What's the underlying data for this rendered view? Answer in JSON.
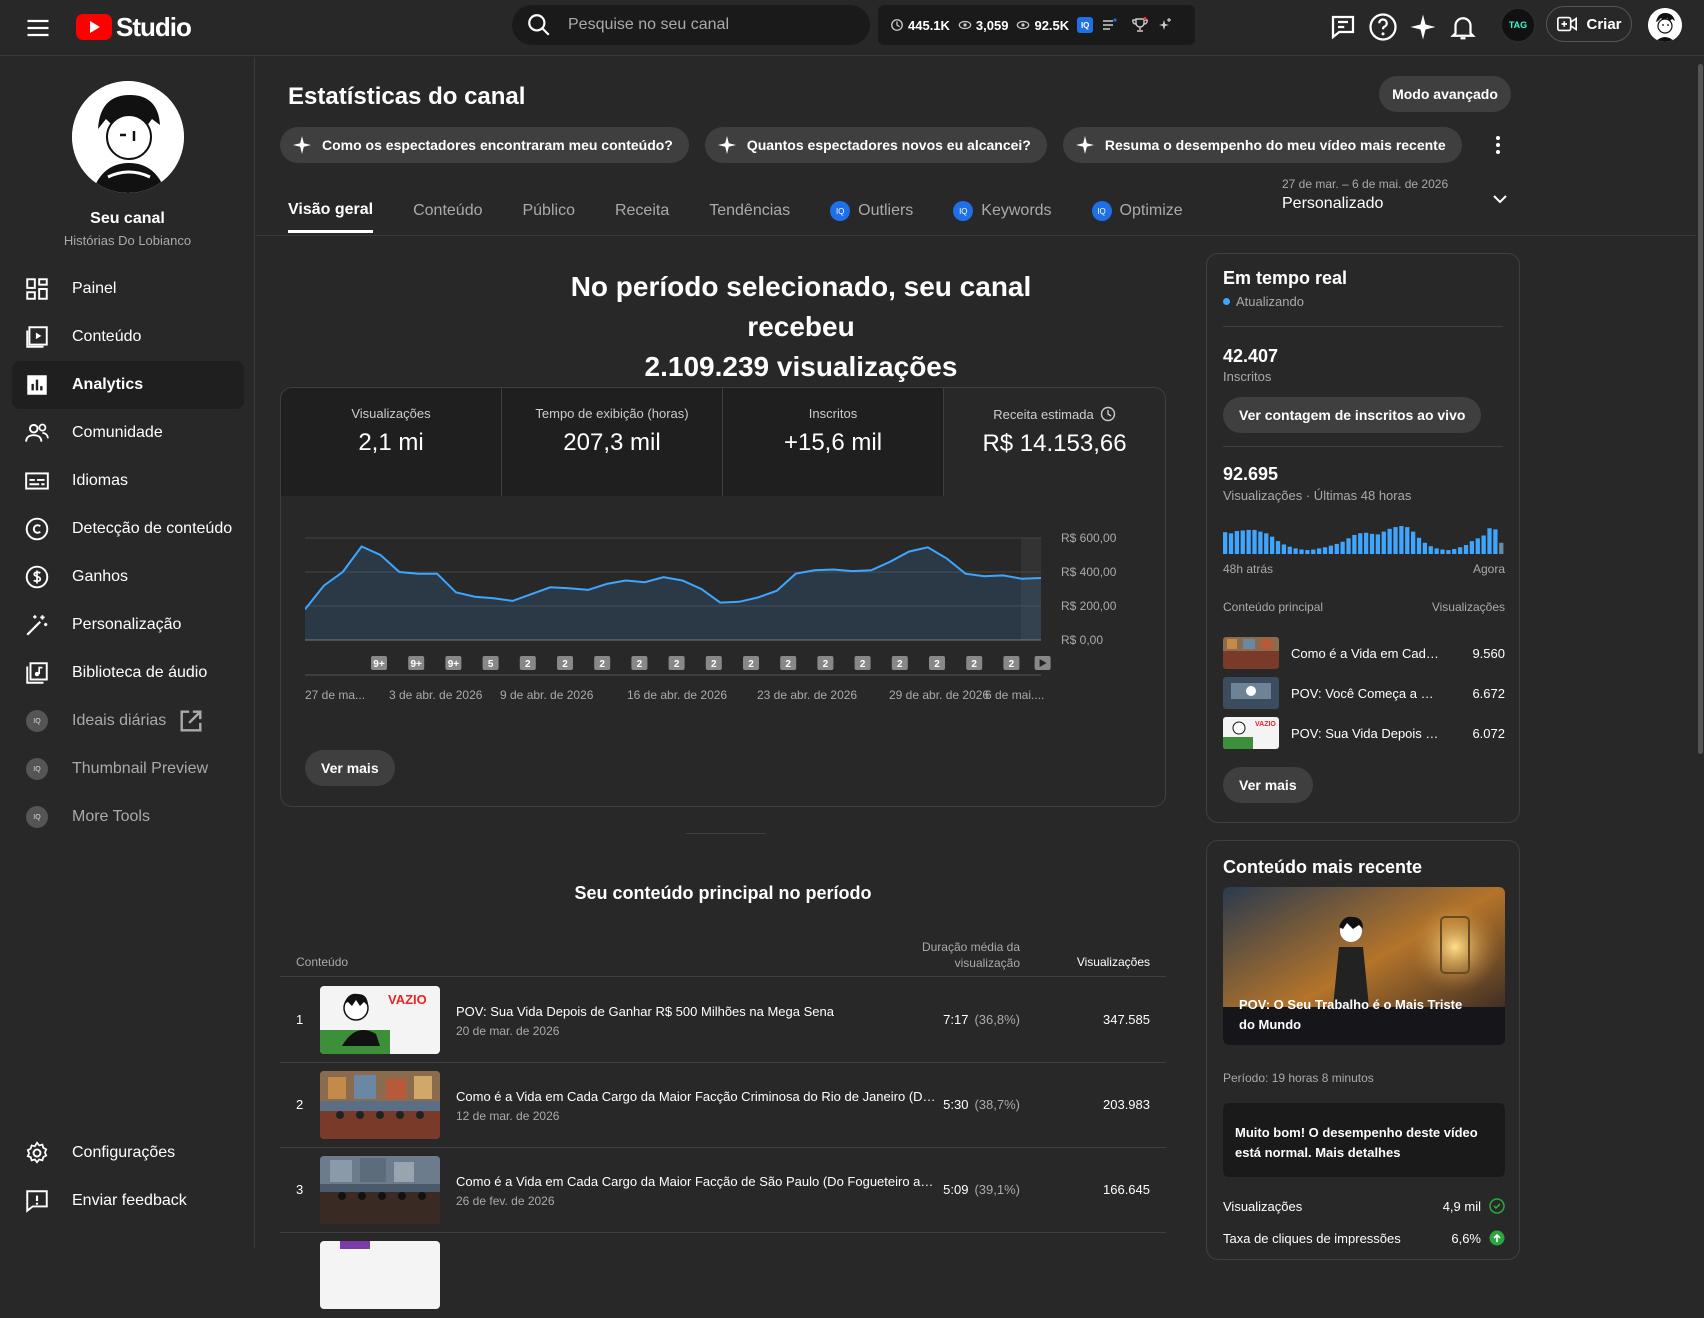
{
  "topbar": {
    "logo_text": "Studio",
    "search_placeholder": "Pesquise no seu canal",
    "ext_stats": [
      "445.1K",
      "3,059",
      "92.5K"
    ],
    "ext_badge": "IQ",
    "ext_avatar": "TAG",
    "create_label": "Criar"
  },
  "sidebar": {
    "channel_name": "Seu canal",
    "channel_sub": "Histórias Do Lobianco",
    "items": [
      {
        "label": "Painel",
        "icon": "dashboard-icon"
      },
      {
        "label": "Conteúdo",
        "icon": "content-icon"
      },
      {
        "label": "Analytics",
        "icon": "analytics-icon"
      },
      {
        "label": "Comunidade",
        "icon": "community-icon"
      },
      {
        "label": "Idiomas",
        "icon": "subtitles-icon"
      },
      {
        "label": "Detecção de conteúdo",
        "icon": "copyright-icon"
      },
      {
        "label": "Ganhos",
        "icon": "dollar-icon"
      },
      {
        "label": "Personalização",
        "icon": "magic-wand-icon"
      },
      {
        "label": "Biblioteca de áudio",
        "icon": "audio-library-icon"
      }
    ],
    "ext_items": [
      {
        "label": "Ideais diárias"
      },
      {
        "label": "Thumbnail Preview"
      },
      {
        "label": "More Tools"
      }
    ],
    "bottom": [
      {
        "label": "Configurações"
      },
      {
        "label": "Enviar feedback"
      }
    ]
  },
  "main": {
    "title": "Estatísticas do canal",
    "advanced_label": "Modo avançado",
    "chips": [
      "Como os espectadores encontraram meu conteúdo?",
      "Quantos espectadores novos eu alcancei?",
      "Resuma o desempenho do meu vídeo mais recente"
    ],
    "tabs": [
      "Visão geral",
      "Conteúdo",
      "Público",
      "Receita",
      "Tendências",
      "Outliers",
      "Keywords",
      "Optimize"
    ],
    "tab_badge": "IQ",
    "date_range_sub": "27 de mar. – 6 de mai. de 2026",
    "date_range_value": "Personalizado",
    "headline_1": "No período selecionado, seu canal recebeu",
    "headline_2": "2.109.239 visualizações",
    "metrics": [
      {
        "label": "Visualizações",
        "value": "2,1 mi"
      },
      {
        "label": "Tempo de exibição (horas)",
        "value": "207,3 mil"
      },
      {
        "label": "Inscritos",
        "value": "+15,6 mil"
      },
      {
        "label": "Receita estimada",
        "value": "R$ 14.153,66"
      }
    ],
    "see_more": "Ver mais",
    "top_content_title": "Seu conteúdo principal no período",
    "table": {
      "col_content": "Conteúdo",
      "col_duration_1": "Duração média da",
      "col_duration_2": "visualização",
      "col_views": "Visualizações",
      "rows": [
        {
          "rank": "1",
          "title": "POV: Sua Vida Depois de Ganhar R$ 500 Milhões na Mega Sena",
          "date": "20 de mar. de 2026",
          "duration": "7:17",
          "pct": "(36,8%)",
          "views": "347.585"
        },
        {
          "rank": "2",
          "title": "Como é a Vida em Cada Cargo da Maior Facção Criminosa do Rio de Janeiro (Do...",
          "date": "12 de mar. de 2026",
          "duration": "5:30",
          "pct": "(38,7%)",
          "views": "203.983"
        },
        {
          "rank": "3",
          "title": "Como é a Vida em Cada Cargo da Maior Facção de São Paulo (Do Fogueteiro ao ...",
          "date": "26 de fev. de 2026",
          "duration": "5:09",
          "pct": "(39,1%)",
          "views": "166.645"
        }
      ]
    }
  },
  "chart_data": {
    "type": "area",
    "series": [
      {
        "values": [
          180,
          320,
          400,
          550,
          500,
          400,
          390,
          390,
          280,
          255,
          245,
          230,
          270,
          310,
          305,
          295,
          330,
          350,
          340,
          370,
          350,
          300,
          220,
          225,
          250,
          290,
          390,
          410,
          415,
          405,
          410,
          460,
          520,
          545,
          480,
          390,
          375,
          380,
          360,
          365
        ]
      }
    ],
    "x_tick_labels": [
      "27 de ma...",
      "3 de abr. de 2026",
      "9 de abr. de 2026",
      "16 de abr. de 2026",
      "23 de abr. de 2026",
      "29 de abr. de 2026",
      "6 de mai...."
    ],
    "y_tick_labels": [
      "R$ 600,00",
      "R$ 400,00",
      "R$ 200,00",
      "R$ 0,00"
    ],
    "ylim": [
      0,
      600
    ],
    "marker_labels": [
      "9+",
      "9+",
      "9+",
      "5",
      "2",
      "2",
      "2",
      "2",
      "2",
      "2",
      "2",
      "2",
      "2",
      "2",
      "2",
      "2",
      "2",
      "2"
    ],
    "color": "#3ea6ff"
  },
  "realtime": {
    "title": "Em tempo real",
    "status": "Atualizando",
    "subs_value": "42.407",
    "subs_label": "Inscritos",
    "live_btn": "Ver contagem de inscritos ao vivo",
    "views_value": "92.695",
    "views_label": "Visualizações · Últimas 48 horas",
    "bars": [
      0.78,
      0.74,
      0.82,
      0.84,
      0.86,
      0.86,
      0.8,
      0.74,
      0.62,
      0.46,
      0.34,
      0.26,
      0.2,
      0.16,
      0.14,
      0.16,
      0.2,
      0.24,
      0.3,
      0.36,
      0.44,
      0.56,
      0.68,
      0.74,
      0.76,
      0.72,
      0.7,
      0.8,
      0.9,
      0.96,
      1.0,
      0.96,
      0.8,
      0.58,
      0.4,
      0.28,
      0.2,
      0.16,
      0.14,
      0.18,
      0.24,
      0.32,
      0.46,
      0.56,
      0.66,
      0.92,
      0.88,
      0.4
    ],
    "axis_left": "48h atrás",
    "axis_right": "Agora",
    "list_head_left": "Conteúdo principal",
    "list_head_right": "Visualizações",
    "items": [
      {
        "title": "Como é a Vida em Cada Cargo",
        "views": "9.560"
      },
      {
        "title": "POV: Você Começa a Minerar",
        "views": "6.672"
      },
      {
        "title": "POV: Sua Vida Depois de Ganhar",
        "views": "6.072"
      }
    ],
    "see_more": "Ver mais"
  },
  "recent": {
    "title": "Conteúdo mais recente",
    "video_title": "POV: O Seu Trabalho é o Mais Triste do Mundo",
    "period": "Período: 19 horas 8 minutos",
    "perf_text": "Muito bom! O desempenho deste vídeo está normal. Mais detalhes",
    "metric_1_label": "Visualizações",
    "metric_1_value": "4,9 mil",
    "metric_2_label": "Taxa de cliques de impressões",
    "metric_2_value": "6,6%"
  }
}
